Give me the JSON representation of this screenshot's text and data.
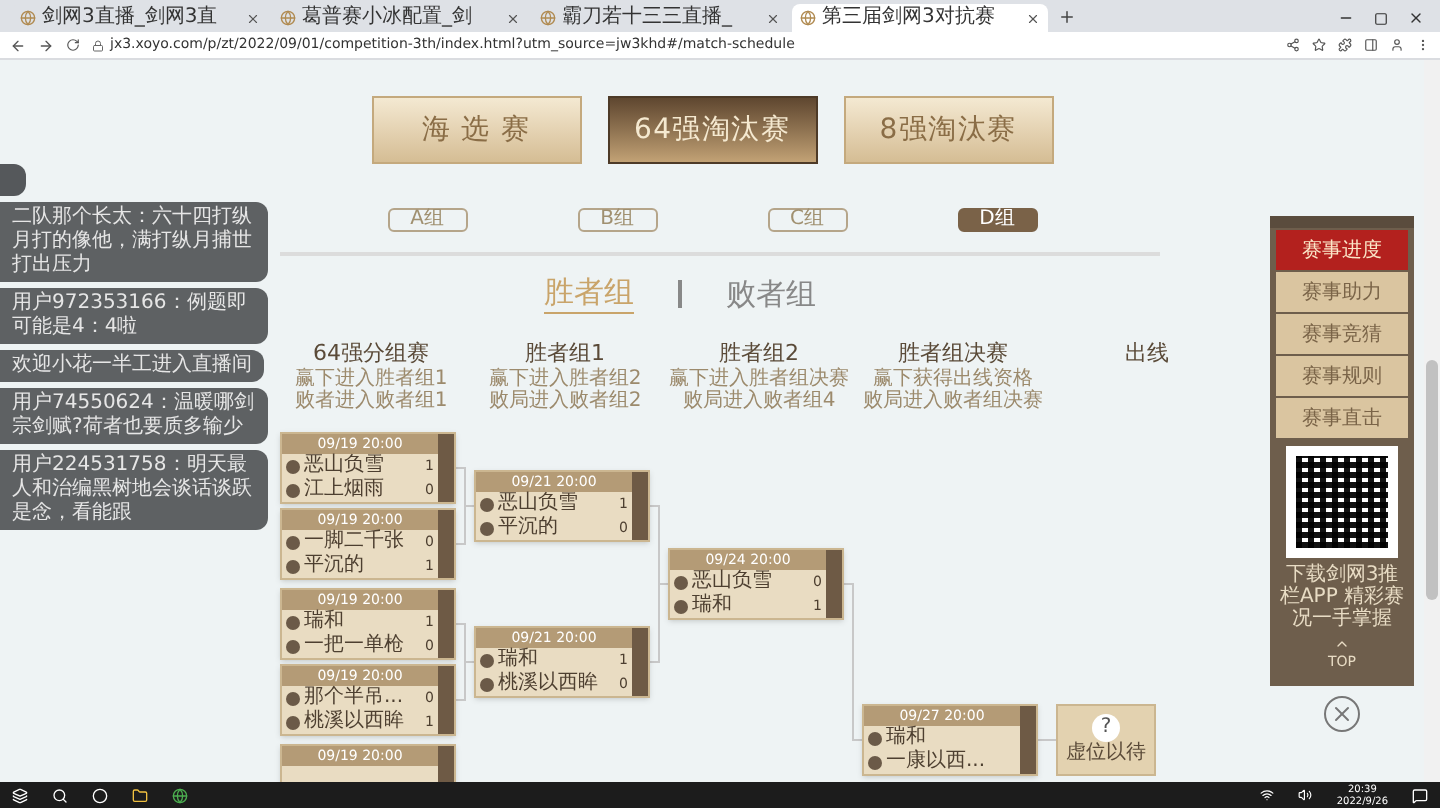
{
  "browser": {
    "tabs": [
      {
        "title": "剑网3直播_剑网3直",
        "selected": false
      },
      {
        "title": "葛普赛小冰配置_剑",
        "selected": false
      },
      {
        "title": "霸刀若十三三直播_",
        "selected": false
      },
      {
        "title": "第三届剑网3对抗赛",
        "selected": true
      }
    ],
    "address": "jx3.xoyo.com/p/zt/2022/09/01/competition-3th/index.html?utm_source=jw3khd#/match-schedule"
  },
  "stages": [
    {
      "label": "海 选 赛",
      "selected": false
    },
    {
      "label": "64强淘汰赛",
      "selected": true
    },
    {
      "label": "8强淘汰赛",
      "selected": false
    }
  ],
  "groups": [
    {
      "label": "A组",
      "selected": false
    },
    {
      "label": "B组",
      "selected": false
    },
    {
      "label": "C组",
      "selected": false
    },
    {
      "label": "D组",
      "selected": true
    }
  ],
  "brackets": [
    {
      "label": "胜者组",
      "selected": true
    },
    {
      "label": "败者组",
      "selected": false
    }
  ],
  "columns": [
    {
      "title": "64强分组赛",
      "notes": [
        "赢下进入胜者组1",
        "败者进入败者组1"
      ]
    },
    {
      "title": "胜者组1",
      "notes": [
        "赢下进入胜者组2",
        "败局进入败者组2"
      ]
    },
    {
      "title": "胜者组2",
      "notes": [
        "赢下进入胜者组决赛",
        "败局进入败者组4"
      ]
    },
    {
      "title": "胜者组决赛",
      "notes": [
        "赢下获得出线资格",
        "败局进入败者组决赛"
      ]
    },
    {
      "title": "出线"
    }
  ],
  "rounds": [
    [
      {
        "time": "09/19 20:00",
        "teams": [
          {
            "name": "恶山负雪",
            "score": "1"
          },
          {
            "name": "江上烟雨",
            "score": "0"
          }
        ]
      },
      {
        "time": "09/19 20:00",
        "teams": [
          {
            "name": "一脚二千张",
            "score": "0"
          },
          {
            "name": "平沉的",
            "score": "1"
          }
        ]
      },
      {
        "time": "09/19 20:00",
        "teams": [
          {
            "name": "瑞和",
            "score": "1"
          },
          {
            "name": "一把一单枪",
            "score": "0"
          }
        ]
      },
      {
        "time": "09/19 20:00",
        "teams": [
          {
            "name": "那个半吊...",
            "score": "0"
          },
          {
            "name": "桃溪以西眸",
            "score": "1"
          }
        ]
      },
      {
        "time": "09/19 20:00"
      }
    ],
    [
      {
        "time": "09/21 20:00",
        "teams": [
          {
            "name": "恶山负雪",
            "score": "1"
          },
          {
            "name": "平沉的",
            "score": "0"
          }
        ]
      },
      {
        "time": "09/21 20:00",
        "teams": [
          {
            "name": "瑞和",
            "score": "1"
          },
          {
            "name": "桃溪以西眸",
            "score": "0"
          }
        ]
      }
    ],
    [
      {
        "time": "09/24 20:00",
        "teams": [
          {
            "name": "恶山负雪",
            "score": "0"
          },
          {
            "name": "瑞和",
            "score": "1"
          }
        ]
      }
    ],
    [
      {
        "time": "09/27 20:00",
        "teams": [
          {
            "name": "瑞和"
          },
          {
            "name": "一康以西..."
          }
        ]
      }
    ]
  ],
  "result": {
    "mark": "?",
    "label": "虚位以待"
  },
  "sidebar": {
    "items": [
      {
        "label": "赛事进度",
        "selected": true
      },
      {
        "label": "赛事助力",
        "selected": false
      },
      {
        "label": "赛事竞猜",
        "selected": false
      },
      {
        "label": "赛事规则",
        "selected": false
      },
      {
        "label": "赛事直击",
        "selected": false
      }
    ],
    "qr_caption": "下载剑网3推栏APP 精彩赛况一手掌握",
    "top": "TOP"
  },
  "chat": [
    "二队那个长太：六十四打纵月打的像他，满打纵月捕世打出压力",
    "用户972353166：例题即可能是4：4啦",
    "欢迎小花一半工进入直播间",
    "用户74550624：温暖哪剑宗剑赋?荷者也要质多输少",
    "用户224531758：明天最人和治编黑树地会谈话谈跃是念，看能跟"
  ],
  "taskbar": {
    "time": "20:39",
    "date": "2022/9/26"
  }
}
